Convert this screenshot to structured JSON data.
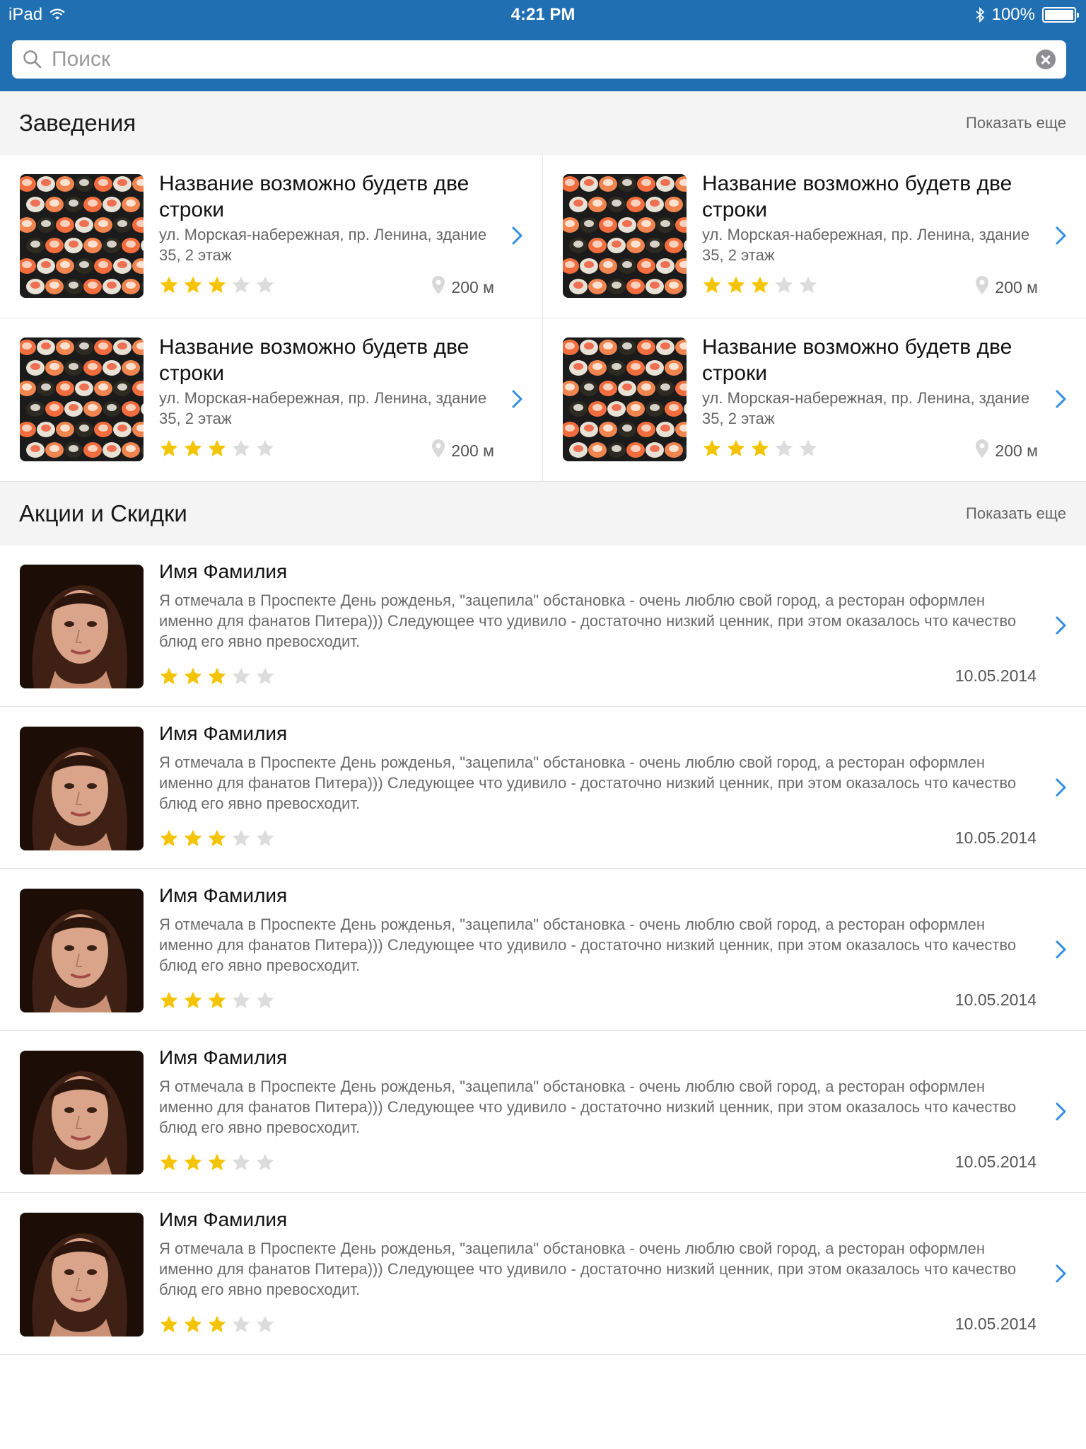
{
  "status_bar": {
    "device": "iPad",
    "time": "4:21 PM",
    "battery": "100%"
  },
  "search": {
    "placeholder": "Поиск",
    "value": ""
  },
  "venues_section": {
    "title": "Заведения",
    "more_label": "Показать еще",
    "items": [
      {
        "name": "Название возможно будетв две строки",
        "address": "ул. Морская-набережная, пр. Ленина, здание 35, 2 этаж",
        "rating": 3,
        "max_rating": 5,
        "distance": "200 м"
      },
      {
        "name": "Название возможно будетв две строки",
        "address": "ул. Морская-набережная, пр. Ленина, здание 35, 2 этаж",
        "rating": 3,
        "max_rating": 5,
        "distance": "200 м"
      },
      {
        "name": "Название возможно будетв две строки",
        "address": "ул. Морская-набережная, пр. Ленина, здание 35, 2 этаж",
        "rating": 3,
        "max_rating": 5,
        "distance": "200 м"
      },
      {
        "name": "Название возможно будетв две строки",
        "address": "ул. Морская-набережная, пр. Ленина, здание 35, 2 этаж",
        "rating": 3,
        "max_rating": 5,
        "distance": "200 м"
      }
    ]
  },
  "promos_section": {
    "title": "Акции и Скидки",
    "more_label": "Показать еще",
    "items": [
      {
        "author": "Имя Фамилия",
        "text": "Я отмечала в Проспекте День рожденья, \"зацепила\" обстановка - очень люблю свой город, а ресторан оформлен именно для фанатов Питера))) Следующее что удивило - достаточно низкий ценник, при этом оказалось что качество блюд его явно превосходит.",
        "rating": 3,
        "max_rating": 5,
        "date": "10.05.2014"
      },
      {
        "author": "Имя Фамилия",
        "text": "Я отмечала в Проспекте День рожденья, \"зацепила\" обстановка - очень люблю свой город, а ресторан оформлен именно для фанатов Питера))) Следующее что удивило - достаточно низкий ценник, при этом оказалось что качество блюд его явно превосходит.",
        "rating": 3,
        "max_rating": 5,
        "date": "10.05.2014"
      },
      {
        "author": "Имя Фамилия",
        "text": "Я отмечала в Проспекте День рожденья, \"зацепила\" обстановка - очень люблю свой город, а ресторан оформлен именно для фанатов Питера))) Следующее что удивило - достаточно низкий ценник, при этом оказалось что качество блюд его явно превосходит.",
        "rating": 3,
        "max_rating": 5,
        "date": "10.05.2014"
      },
      {
        "author": "Имя Фамилия",
        "text": "Я отмечала в Проспекте День рожденья, \"зацепила\" обстановка - очень люблю свой город, а ресторан оформлен именно для фанатов Питера))) Следующее что удивило - достаточно низкий ценник, при этом оказалось что качество блюд его явно превосходит.",
        "rating": 3,
        "max_rating": 5,
        "date": "10.05.2014"
      },
      {
        "author": "Имя Фамилия",
        "text": "Я отмечала в Проспекте День рожденья, \"зацепила\" обстановка - очень люблю свой город, а ресторан оформлен именно для фанатов Питера))) Следующее что удивило - достаточно низкий ценник, при этом оказалось что качество блюд его явно превосходит.",
        "rating": 3,
        "max_rating": 5,
        "date": "10.05.2014"
      }
    ]
  },
  "colors": {
    "header_blue": "#1f6fb2",
    "accent_blue": "#2f8de4",
    "star_filled": "#f5c400",
    "star_empty": "#dcdcdc"
  },
  "icons": {
    "search": "magnifier-icon",
    "clear": "clear-x-icon",
    "chevron": "chevron-right-icon",
    "location": "map-pin-icon",
    "star": "star-icon",
    "wifi": "wifi-icon",
    "bluetooth": "bluetooth-icon",
    "battery": "battery-icon"
  }
}
